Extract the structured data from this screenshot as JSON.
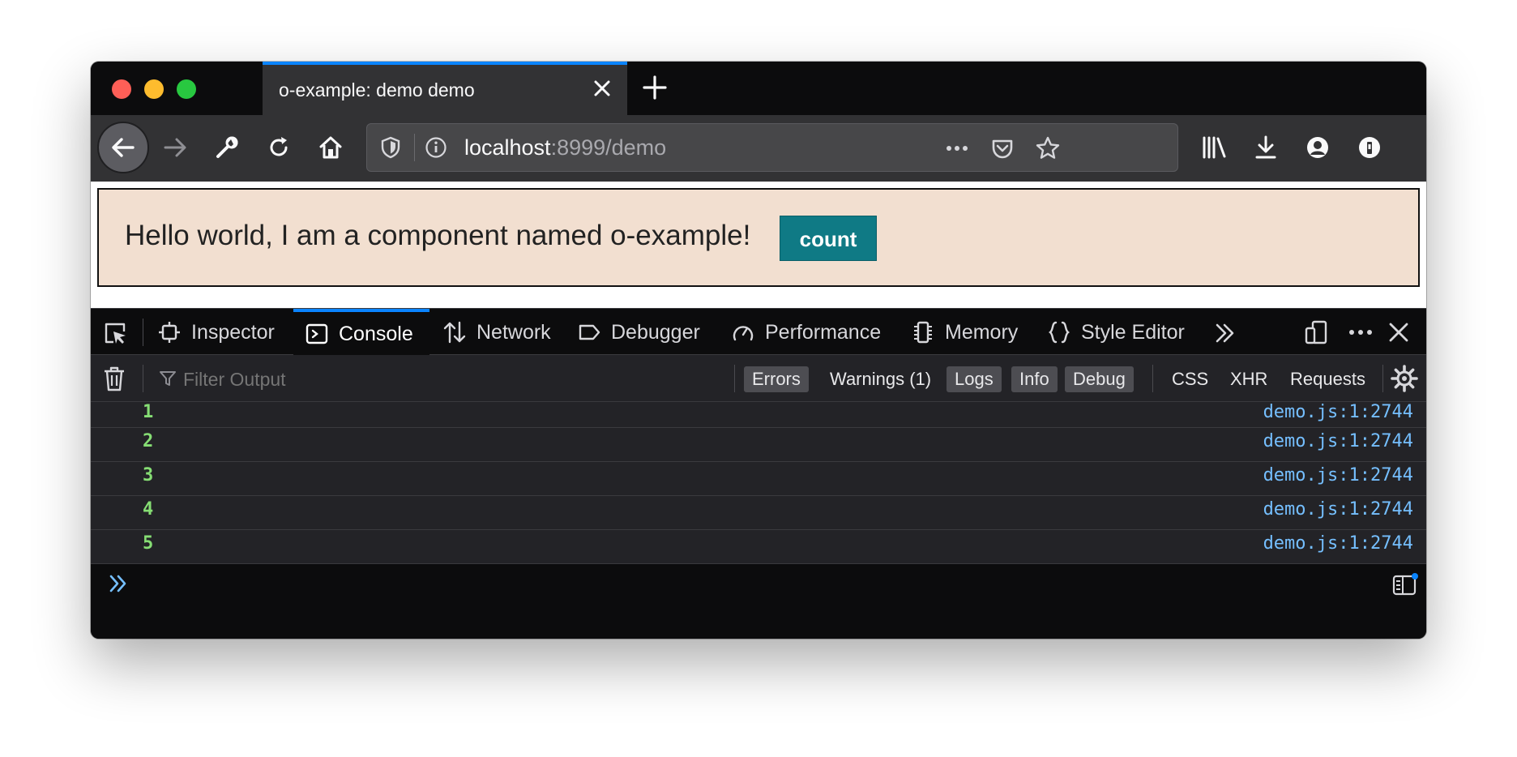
{
  "browser": {
    "tab": {
      "title": "o-example: demo demo"
    },
    "url": {
      "host": "localhost",
      "rest": ":8999/demo"
    }
  },
  "page": {
    "component_text": "Hello world, I am a component named o-example!",
    "count_button_label": "count"
  },
  "devtools": {
    "tabs": [
      {
        "label": "Inspector",
        "icon": "inspector-icon"
      },
      {
        "label": "Console",
        "icon": "console-icon",
        "active": true
      },
      {
        "label": "Network",
        "icon": "network-icon"
      },
      {
        "label": "Debugger",
        "icon": "debugger-icon"
      },
      {
        "label": "Performance",
        "icon": "performance-icon"
      },
      {
        "label": "Memory",
        "icon": "memory-icon"
      },
      {
        "label": "Style Editor",
        "icon": "style-editor-icon"
      }
    ],
    "filter_placeholder": "Filter Output",
    "filters": [
      {
        "label": "Errors",
        "active": true
      },
      {
        "label": "Warnings (1)",
        "active": false
      },
      {
        "label": "Logs",
        "active": true
      },
      {
        "label": "Info",
        "active": true
      },
      {
        "label": "Debug",
        "active": true
      },
      {
        "label": "CSS",
        "active": false
      },
      {
        "label": "XHR",
        "active": false
      },
      {
        "label": "Requests",
        "active": false
      }
    ],
    "messages": [
      {
        "value": "1",
        "source": "demo.js:1:2744"
      },
      {
        "value": "2",
        "source": "demo.js:1:2744"
      },
      {
        "value": "3",
        "source": "demo.js:1:2744"
      },
      {
        "value": "4",
        "source": "demo.js:1:2744"
      },
      {
        "value": "5",
        "source": "demo.js:1:2744"
      }
    ]
  },
  "colors": {
    "accent": "#0a84ff",
    "component_bg": "#f2dfd0",
    "count_button_bg": "#0f7a85",
    "log_value": "#86de74",
    "log_source": "#75bfff"
  }
}
